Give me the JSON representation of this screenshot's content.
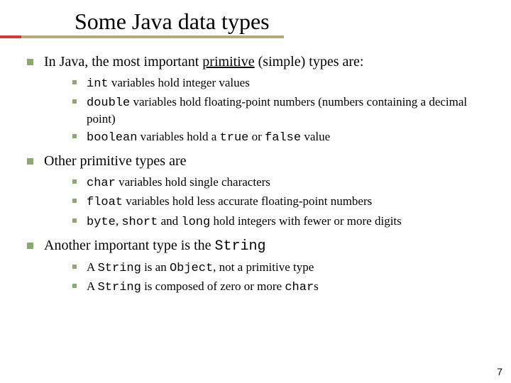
{
  "title": "Some Java data types",
  "bullets": [
    {
      "text_parts": [
        "In Java, the most important ",
        "primitive",
        " (simple) types are:"
      ],
      "sub": [
        {
          "parts": [
            {
              "t": "int",
              "c": true
            },
            {
              "t": " variables hold integer values"
            }
          ]
        },
        {
          "parts": [
            {
              "t": "double",
              "c": true
            },
            {
              "t": " variables hold floating-point numbers (numbers containing a decimal point)"
            }
          ]
        },
        {
          "parts": [
            {
              "t": "boolean",
              "c": true
            },
            {
              "t": " variables hold a "
            },
            {
              "t": "true",
              "c": true
            },
            {
              "t": " or "
            },
            {
              "t": "false",
              "c": true
            },
            {
              "t": " value"
            }
          ]
        }
      ]
    },
    {
      "text_parts": [
        "Other primitive types are"
      ],
      "sub": [
        {
          "parts": [
            {
              "t": "char",
              "c": true
            },
            {
              "t": " variables hold single characters"
            }
          ]
        },
        {
          "parts": [
            {
              "t": "float",
              "c": true
            },
            {
              "t": " variables hold less accurate floating-point numbers"
            }
          ]
        },
        {
          "parts": [
            {
              "t": "byte",
              "c": true
            },
            {
              "t": ", "
            },
            {
              "t": "short",
              "c": true
            },
            {
              "t": " and "
            },
            {
              "t": "long",
              "c": true
            },
            {
              "t": " hold integers with fewer or more digits"
            }
          ]
        }
      ]
    },
    {
      "text_parts_rich": [
        {
          "t": "Another important type is the "
        },
        {
          "t": "String",
          "c": true
        }
      ],
      "sub": [
        {
          "parts": [
            {
              "t": "A "
            },
            {
              "t": "String",
              "c": true
            },
            {
              "t": " is an "
            },
            {
              "t": "Object",
              "c": true
            },
            {
              "t": ", not a primitive type"
            }
          ]
        },
        {
          "parts": [
            {
              "t": "A "
            },
            {
              "t": "String",
              "c": true
            },
            {
              "t": " is composed of zero or more "
            },
            {
              "t": "char",
              "c": true
            },
            {
              "t": "s"
            }
          ]
        }
      ]
    }
  ],
  "page_number": "7"
}
